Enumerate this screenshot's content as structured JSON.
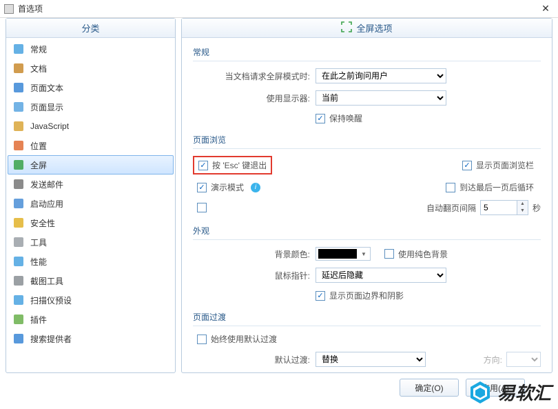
{
  "window": {
    "title": "首选项"
  },
  "sidebar": {
    "header": "分类",
    "items": [
      {
        "label": "常规",
        "icon_color": "#4aa3e0"
      },
      {
        "label": "文档",
        "icon_color": "#c98b2f"
      },
      {
        "label": "页面文本",
        "icon_color": "#3b87d6"
      },
      {
        "label": "页面显示",
        "icon_color": "#5ba6e0"
      },
      {
        "label": "JavaScript",
        "icon_color": "#d9a63a"
      },
      {
        "label": "位置",
        "icon_color": "#e06d36"
      },
      {
        "label": "全屏",
        "icon_color": "#3aa24a",
        "selected": true
      },
      {
        "label": "发送邮件",
        "icon_color": "#777"
      },
      {
        "label": "启动应用",
        "icon_color": "#4a8ed6"
      },
      {
        "label": "安全性",
        "icon_color": "#e2b32a"
      },
      {
        "label": "工具",
        "icon_color": "#9aa0a6"
      },
      {
        "label": "性能",
        "icon_color": "#4aa3e0"
      },
      {
        "label": "截图工具",
        "icon_color": "#8a8f94"
      },
      {
        "label": "扫描仪预设",
        "icon_color": "#4aa3e0"
      },
      {
        "label": "插件",
        "icon_color": "#6ab04c"
      },
      {
        "label": "搜索提供者",
        "icon_color": "#3b87d6"
      }
    ]
  },
  "main": {
    "header": "全屏选项",
    "groups": {
      "general": {
        "title": "常规",
        "doc_request_label": "当文档请求全屏模式时:",
        "doc_request_value": "在此之前询问用户",
        "monitor_label": "使用显示器:",
        "monitor_value": "当前",
        "keep_awake_label": "保持唤醒"
      },
      "browsing": {
        "title": "页面浏览",
        "esc_label": "按 'Esc' 键退出",
        "show_nav_label": "显示页面浏览栏",
        "present_label": "演示模式",
        "loop_label": "到达最后一页后循环",
        "auto_flip_label": "自动翻页间隔",
        "auto_flip_value": "5",
        "seconds": "秒"
      },
      "appearance": {
        "title": "外观",
        "bg_color_label": "背景颜色:",
        "solid_bg_label": "使用纯色背景",
        "pointer_label": "鼠标指针:",
        "pointer_value": "延迟后隐藏",
        "show_border_label": "显示页面边界和阴影"
      },
      "transition": {
        "title": "页面过渡",
        "always_default_label": "始终使用默认过渡",
        "default_trans_label": "默认过渡:",
        "default_trans_value": "替换",
        "direction_label": "方向:"
      }
    }
  },
  "buttons": {
    "ok": "确定(O)",
    "apply": "应用(A)"
  },
  "watermark": "易软汇"
}
